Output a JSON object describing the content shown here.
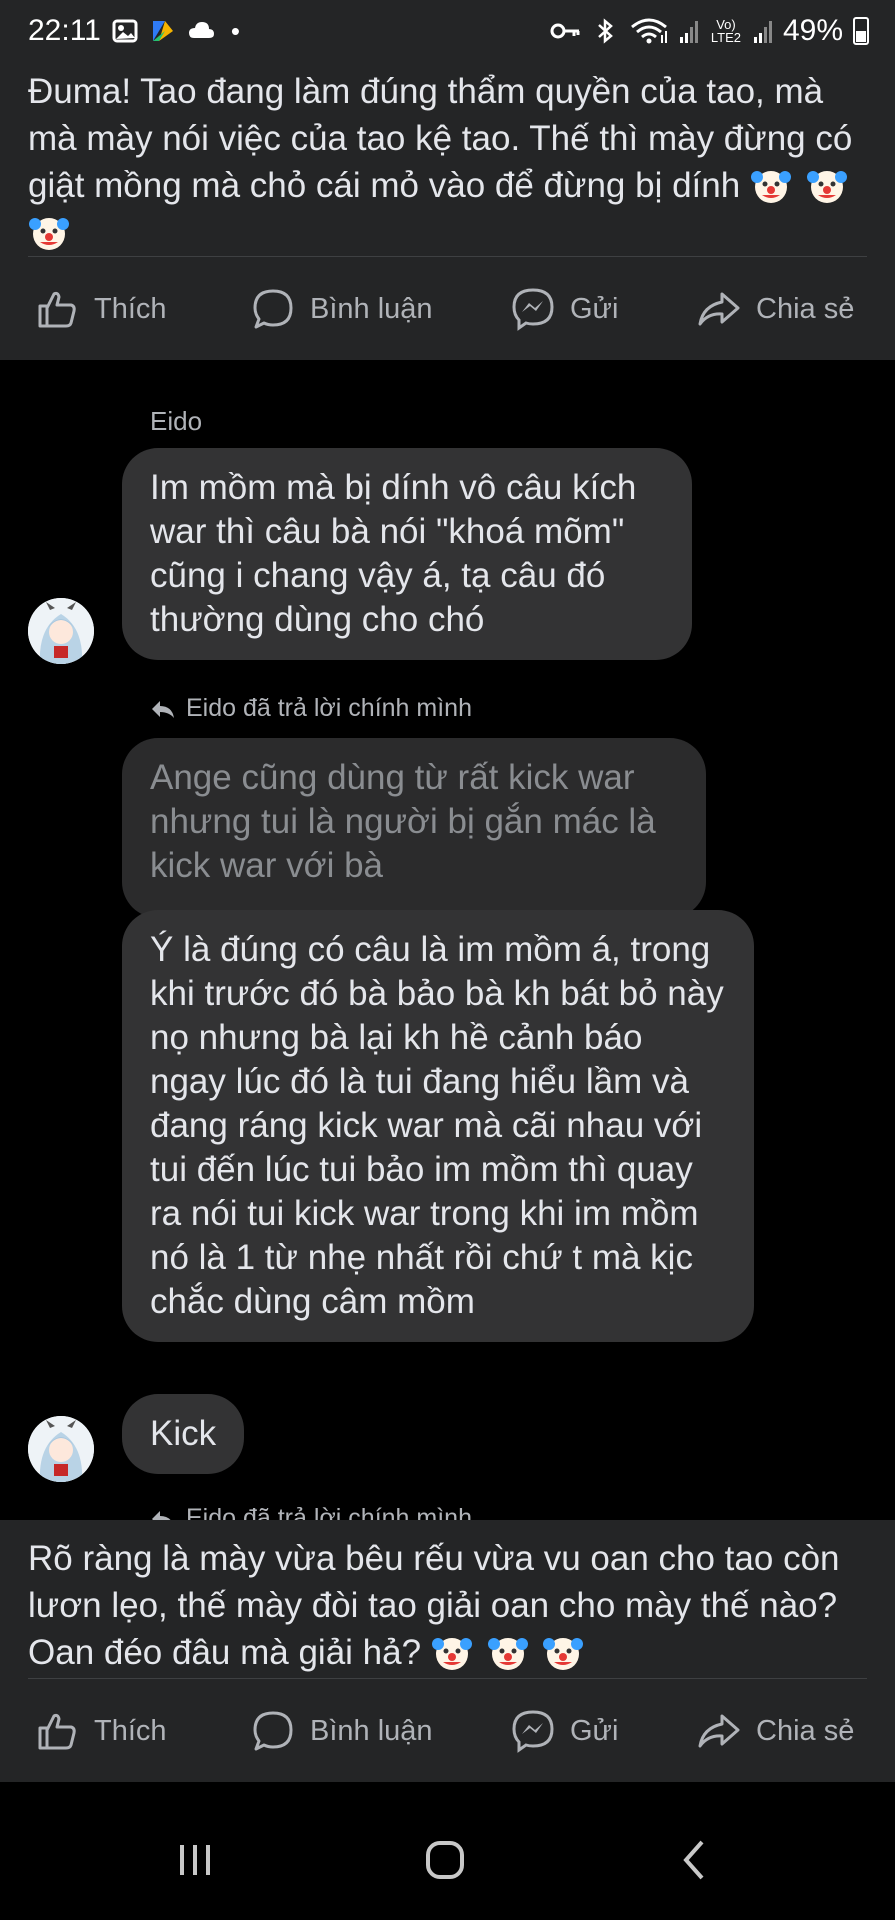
{
  "status_bar": {
    "time": "22:11",
    "dot": "•",
    "network_label": "Vo) LTE2",
    "battery": "49%",
    "icons": [
      "gallery-icon",
      "app-icon",
      "cloud-icon",
      "key-icon",
      "bluetooth-icon",
      "wifi-icon",
      "signal-icon",
      "battery-icon"
    ]
  },
  "post_top": {
    "text": "Đuma! Tao đang làm đúng thẩm quyền của tao, mà mà mày nói việc của tao kệ tao. Thế thì mày đừng có giật mồng mà chỏ cái mỏ vào để đừng bị dính",
    "emoji": [
      "clown-face",
      "clown-face",
      "clown-face"
    ]
  },
  "post_bottom": {
    "text": "Rõ ràng là mày vừa bêu rếu vừa vu oan cho tao còn lươn lẹo, thế mày đòi tao giải oan cho mày thế nào? Oan đéo đâu mà giải hả?",
    "emoji": [
      "clown-face",
      "clown-face",
      "clown-face"
    ]
  },
  "actions": {
    "like": "Thích",
    "comment": "Bình luận",
    "send": "Gửi",
    "share": "Chia sẻ"
  },
  "comments": {
    "author": "Eido",
    "c1": "Im mồm mà bị dính vô câu kích war thì câu bà nói \"khoá mõm\" cũng i chang vậy á, tạ câu đó thường dùng cho chó",
    "reply_note": "Eido đã trả lời chính mình",
    "c2": "Ange cũng dùng từ rất kick war nhưng tui là người bị gắn mác là kick war với bà",
    "c3": "Ý là đúng có câu là im mồm á, trong khi trước đó bà bảo bà kh bát bỏ này nọ nhưng bà lại kh hề cảnh báo ngay lúc đó là tui đang hiểu lầm và đang ráng kick war mà cãi nhau với tui đến lúc tui bảo im mồm thì quay ra nói tui kick war trong khi im mồm nó là 1 từ nhẹ nhất rồi chứ t mà kịc chắc dùng câm mồm",
    "c4": "Kick",
    "reply_note_2": "Eido đã trả lời chính mình"
  },
  "colors": {
    "card_bg": "#242526",
    "bubble_bg": "#333334",
    "text": "#e4e6eb",
    "muted": "#b0b3b8"
  }
}
